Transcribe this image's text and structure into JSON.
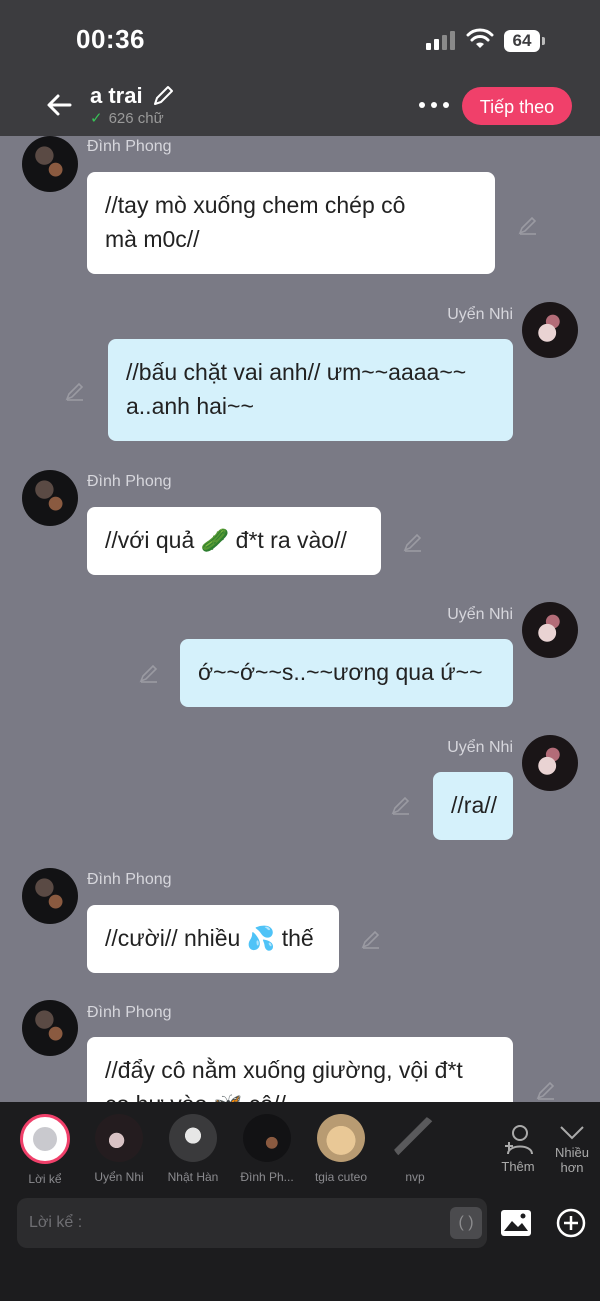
{
  "status": {
    "time": "00:36",
    "battery": "64"
  },
  "header": {
    "title": "a trai",
    "count": "626 chữ",
    "next_label": "Tiếp theo"
  },
  "messages": [
    {
      "side": "left",
      "name": "Đình Phong",
      "lines": [
        "//tay mò xuống chem chép cô",
        "mà m0c//"
      ]
    },
    {
      "side": "right",
      "name": "Uyển Nhi",
      "lines": [
        "//bấu chặt vai anh// ưm~~aaaa~~",
        "a..anh hai~~"
      ]
    },
    {
      "side": "left",
      "name": "Đình Phong",
      "lines": [
        "//với quả 🥒 đ*t ra vào//"
      ]
    },
    {
      "side": "right",
      "name": "Uyển Nhi",
      "lines": [
        "ớ~~ớ~~s..~~ương qua ứ~~"
      ]
    },
    {
      "side": "right",
      "name": "Uyển Nhi",
      "lines": [
        "//ra//"
      ]
    },
    {
      "side": "left",
      "name": "Đình Phong",
      "lines": [
        "//cười// nhiều 💦 thế"
      ]
    },
    {
      "side": "left",
      "name": "Đình Phong",
      "lines": [
        "//đẩy cô nằm xuống giường, vội đ*t",
        "co hư vào 🦋 cô//"
      ]
    }
  ],
  "characters": [
    {
      "label": "Lời kể"
    },
    {
      "label": "Uyển Nhi"
    },
    {
      "label": "Nhật Hàn"
    },
    {
      "label": "Đình Ph..."
    },
    {
      "label": "tgia cuteo"
    },
    {
      "label": "nvp"
    }
  ],
  "actions": {
    "add_label": "Thêm",
    "more_label_1": "Nhiều",
    "more_label_2": "hơn"
  },
  "composer": {
    "placeholder": "Lời kể :",
    "paren": "( )"
  }
}
